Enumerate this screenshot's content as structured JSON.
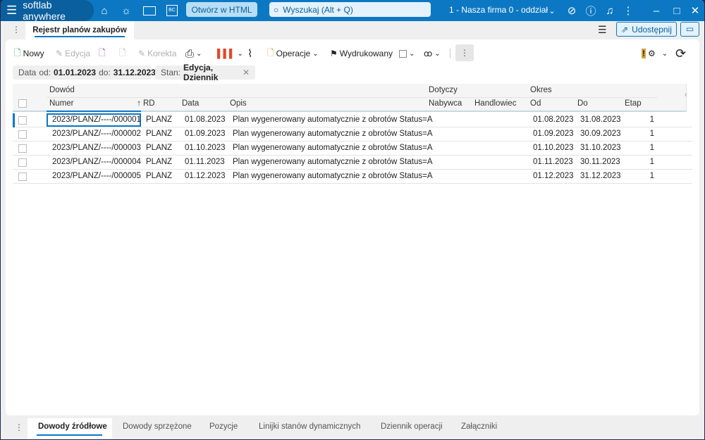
{
  "titlebar": {
    "app_name": "softlab anywhere",
    "open_html": "Otwórz w HTML",
    "search_placeholder": "Wyszukaj (Alt + Q)",
    "firm": "1 - Nasza firma 0 - oddział",
    "icons": [
      "menu-icon",
      "home-icon",
      "lightbulb-icon",
      "news-icon",
      "bc-icon",
      "search-icon",
      "chevron-down-icon",
      "mic-off-icon",
      "help-icon",
      "bell-icon",
      "more-icon",
      "minimize-icon",
      "maximize-icon",
      "close-icon"
    ],
    "bc_label": "BC"
  },
  "tabs": {
    "main": "Rejestr planów zakupów",
    "share": "Udostępnij"
  },
  "toolbar": {
    "new": "Nowy",
    "edit": "Edycja",
    "correction": "Korekta",
    "operations": "Operacje",
    "printed": "Wydrukowany"
  },
  "filters": {
    "date_label": "Data",
    "from_label": "od:",
    "from": "01.01.2023",
    "to_label": "do:",
    "to": "31.12.2023",
    "state_label": "Stan:",
    "state": "Edycja, Dziennik"
  },
  "grid": {
    "groups": {
      "dowod": "Dowód",
      "dotyczy": "Dotyczy",
      "okres": "Okres"
    },
    "columns": {
      "numer": "Numer",
      "rd": "RD",
      "data": "Data",
      "opis": "Opis",
      "nabywca": "Nabywca",
      "handlowiec": "Handlowiec",
      "od": "Od",
      "do": "Do",
      "etap": "Etap"
    },
    "rows": [
      {
        "numer": "2023/PLANZ/----/000001",
        "rd": "PLANZ",
        "data": "01.08.2023",
        "opis": "Plan wygenerowany automatycznie z obrotów Status=A",
        "nabywca": "",
        "handlowiec": "",
        "od": "01.08.2023",
        "do": "31.08.2023",
        "etap": "1"
      },
      {
        "numer": "2023/PLANZ/----/000002",
        "rd": "PLANZ",
        "data": "01.09.2023",
        "opis": "Plan wygenerowany automatycznie z obrotów Status=A",
        "nabywca": "",
        "handlowiec": "",
        "od": "01.09.2023",
        "do": "30.09.2023",
        "etap": "1"
      },
      {
        "numer": "2023/PLANZ/----/000003",
        "rd": "PLANZ",
        "data": "01.10.2023",
        "opis": "Plan wygenerowany automatycznie z obrotów Status=A",
        "nabywca": "",
        "handlowiec": "",
        "od": "01.10.2023",
        "do": "31.10.2023",
        "etap": "1"
      },
      {
        "numer": "2023/PLANZ/----/000004",
        "rd": "PLANZ",
        "data": "01.11.2023",
        "opis": "Plan wygenerowany automatycznie z obrotów Status=A",
        "nabywca": "",
        "handlowiec": "",
        "od": "01.11.2023",
        "do": "30.11.2023",
        "etap": "1"
      },
      {
        "numer": "2023/PLANZ/----/000005",
        "rd": "PLANZ",
        "data": "01.12.2023",
        "opis": "Plan wygenerowany automatycznie z obrotów Status=A",
        "nabywca": "",
        "handlowiec": "",
        "od": "01.12.2023",
        "do": "31.12.2023",
        "etap": "1"
      }
    ]
  },
  "bottom_tabs": [
    "Dowody źródłowe",
    "Dowody sprzężone",
    "Pozycje",
    "Linijki stanów dynamicznych",
    "Dziennik operacji",
    "Załączniki"
  ],
  "colors": {
    "accent": "#0c78c4",
    "brand": "#0a5f9e"
  }
}
